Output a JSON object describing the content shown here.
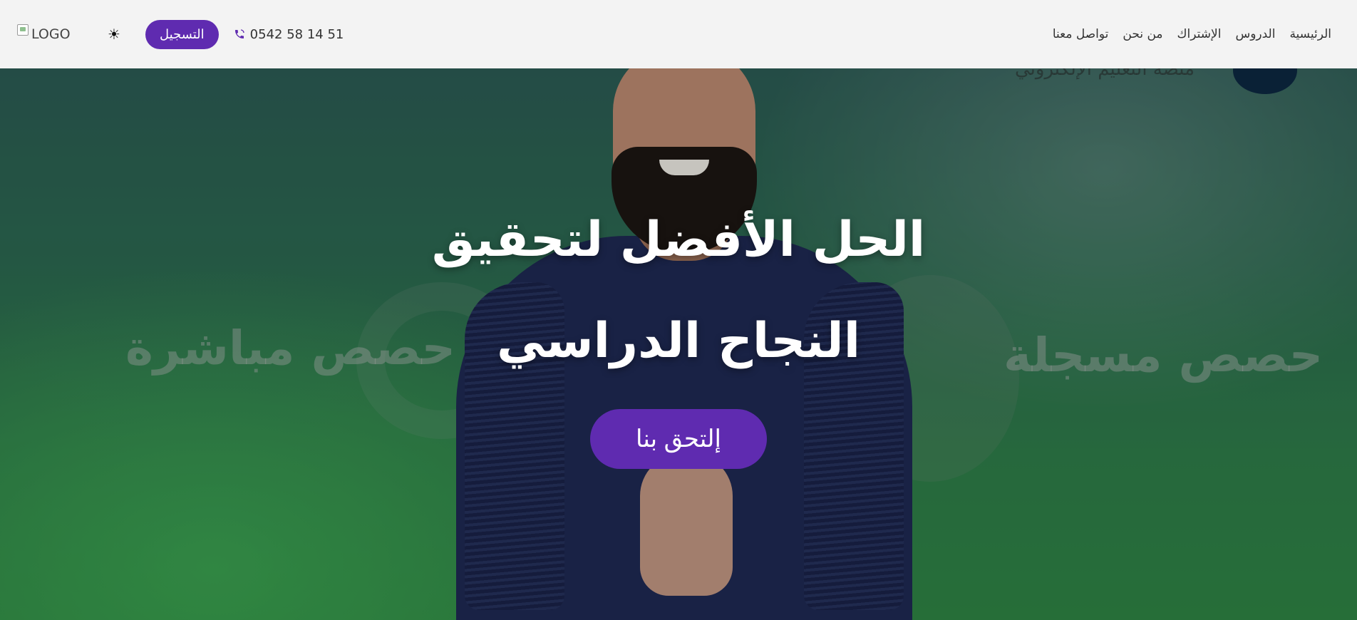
{
  "header": {
    "logo_alt": "LOGO",
    "theme_toggle_icon": "sun-icon",
    "register_label": "التسجيل",
    "phone_icon": "phone-icon",
    "phone_number": "0542 58 14 51",
    "nav": [
      {
        "label": "الرئيسية"
      },
      {
        "label": "الدروس"
      },
      {
        "label": "الإشتراك"
      },
      {
        "label": "من نحن"
      },
      {
        "label": "تواصل معنا"
      }
    ]
  },
  "hero": {
    "title": "الحل الأفضل لتحقيق النجاح الدراسي",
    "cta_label": "إلتحق بنا",
    "background_text": {
      "left": "حصص مباشرة",
      "right": "حصص مسجلة",
      "top_right": "منصة التعليم الإلكتروني"
    }
  },
  "colors": {
    "accent": "#5f2bb0",
    "header_bg": "#f3f3f3"
  }
}
